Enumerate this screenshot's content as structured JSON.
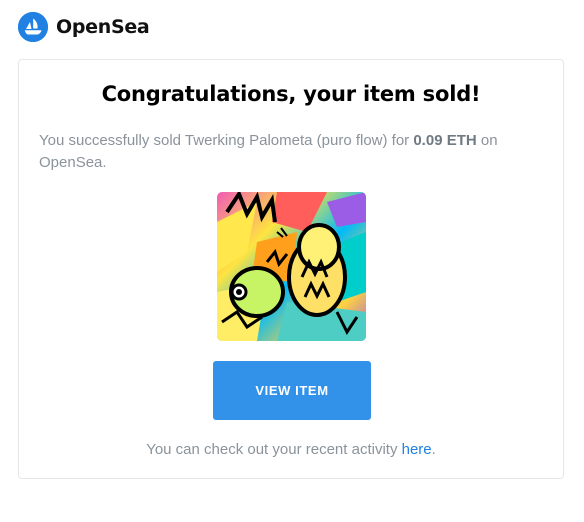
{
  "brand": {
    "name": "OpenSea",
    "logo_icon": "opensea-logo-icon",
    "logo_color": "#2081e2"
  },
  "email": {
    "title": "Congratulations, your item sold!",
    "message_prefix": "You successfully sold Twerking Palometa (puro flow) for ",
    "amount": "0.09 ETH",
    "message_suffix": " on OpenSea.",
    "artwork_icon": "nft-artwork-image",
    "button_label": "VIEW ITEM",
    "footer_prefix": "You can check out your recent activity ",
    "footer_link": "here",
    "footer_suffix": "."
  },
  "colors": {
    "button": "#3291e9",
    "link": "#2081e2",
    "muted_text": "#8a939b"
  }
}
